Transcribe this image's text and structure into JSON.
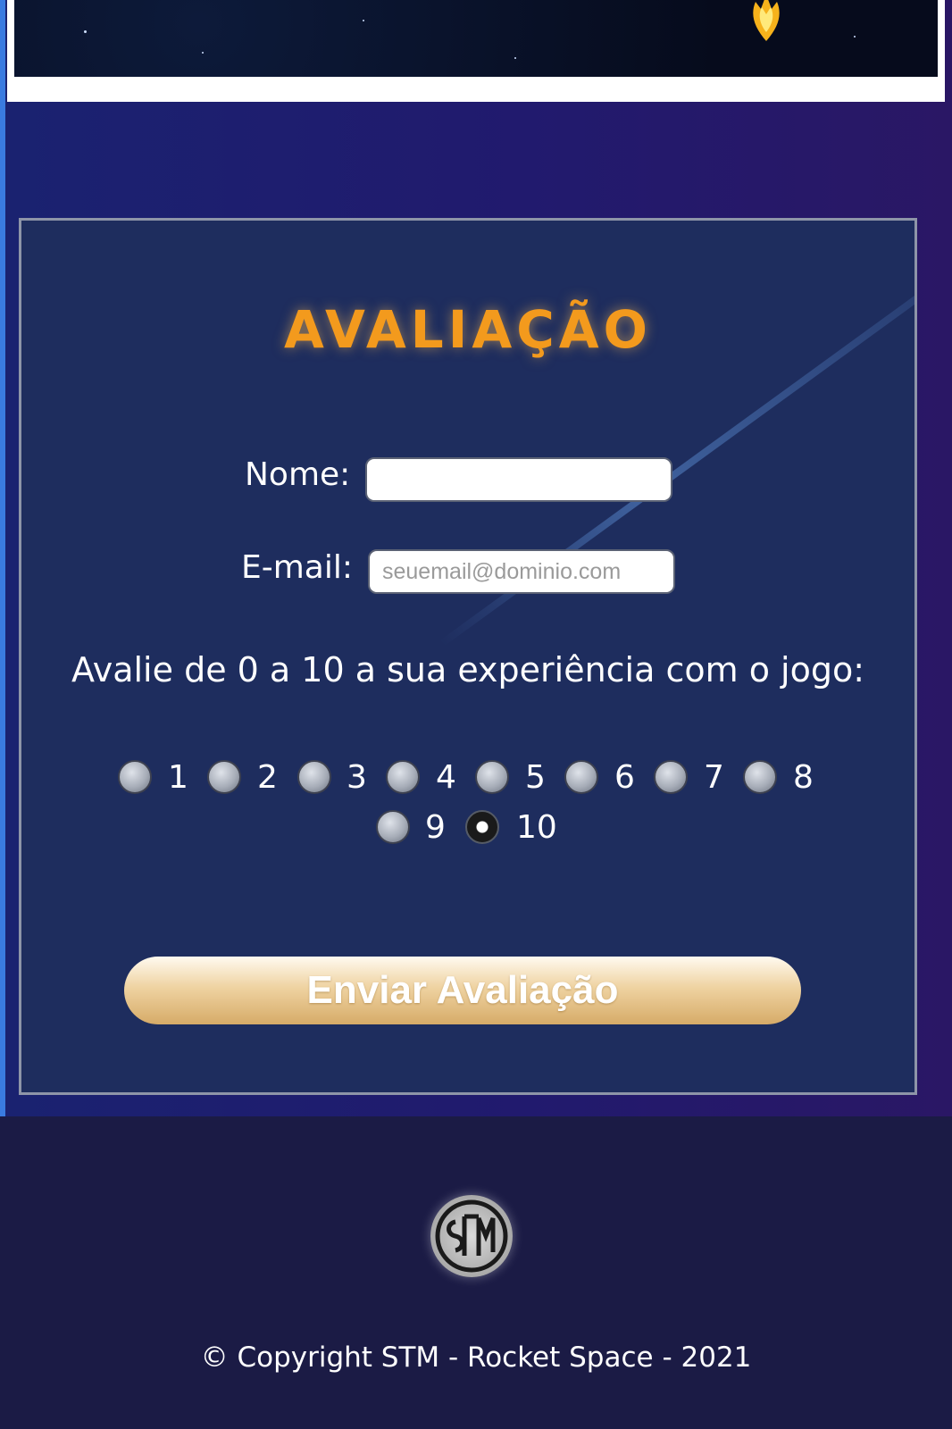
{
  "banner": {
    "image": "space-rocket-banner"
  },
  "form": {
    "title": "AVALIAÇÃO",
    "name_label": "Nome:",
    "name_value": "",
    "email_label": "E-mail:",
    "email_placeholder": "seuemail@dominio.com",
    "rating_question": "Avalie de 0 a 10 a sua experiência com o jogo:",
    "rating_options": [
      "1",
      "2",
      "3",
      "4",
      "5",
      "6",
      "7",
      "8",
      "9",
      "10"
    ],
    "rating_selected": "10",
    "submit_label": "Enviar Avaliação"
  },
  "footer": {
    "logo_icon": "stm-logo-icon",
    "copyright": "© Copyright STM - Rocket Space - 2021"
  },
  "colors": {
    "title": "#f39a1d",
    "card_background": "#1e2d5e",
    "page_background": "#1b1b45",
    "button_gold": "#d6ab68"
  }
}
